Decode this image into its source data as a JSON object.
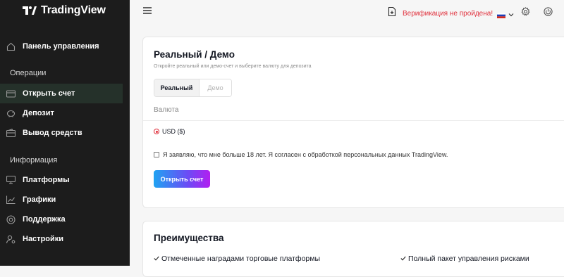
{
  "sidebar": {
    "logo_text": "TradingView",
    "items": [
      {
        "label": "Панель управления",
        "icon": "home-icon"
      },
      {
        "label": "Открыть счет",
        "icon": "card-icon"
      },
      {
        "label": "Депозит",
        "icon": "piggy-bank-icon"
      },
      {
        "label": "Вывод средств",
        "icon": "wallet-icon"
      },
      {
        "label": "Платформы",
        "icon": "monitor-icon"
      },
      {
        "label": "Графики",
        "icon": "chart-icon"
      },
      {
        "label": "Поддержка",
        "icon": "lifebuoy-icon"
      },
      {
        "label": "Настройки",
        "icon": "user-settings-icon"
      }
    ],
    "sections": [
      "Операции",
      "Информация"
    ],
    "active": "Открыть счет"
  },
  "header": {
    "verification_text": "Верификация не пройдена!",
    "language": "ru"
  },
  "account_card": {
    "title": "Реальный / Демо",
    "subtitle": "Откройте реальный или демо-счет и выберите валюту для депозита",
    "segments": [
      "Реальный",
      "Демо"
    ],
    "selected_segment": "Реальный",
    "currency_label": "Валюта",
    "currency_option": "USD ($)",
    "consent_text": "Я заявляю, что мне больше 18 лет. Я согласен с обработкой персональных данных TradingView.",
    "consent_checked": false,
    "submit_label": "Открыть счет"
  },
  "advantages": {
    "title": "Преимущества",
    "items": [
      "Отмеченные наградами торговые платформы",
      "Полный пакет управления рисками"
    ]
  },
  "colors": {
    "sidebar_bg": "#1c1c1c",
    "alert_red": "#e0303c",
    "cta_gradient_start": "#1fa3f2",
    "cta_gradient_end": "#b21ff0"
  }
}
